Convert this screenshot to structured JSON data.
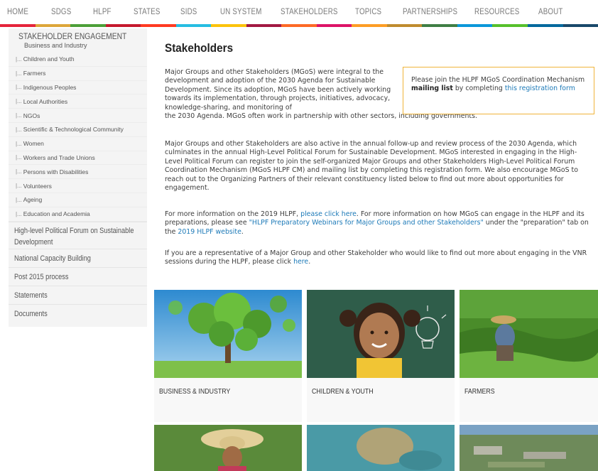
{
  "nav": {
    "items": [
      "HOME",
      "SDGS",
      "HLPF",
      "STATES",
      "SIDS",
      "UN SYSTEM",
      "STAKEHOLDERS",
      "TOPICS",
      "PARTNERSHIPS",
      "RESOURCES",
      "ABOUT"
    ]
  },
  "sdg_colors": [
    "#e5243b",
    "#dda63a",
    "#4c9f38",
    "#c5192d",
    "#ff3a21",
    "#26bde2",
    "#fcc30b",
    "#a21942",
    "#fd6925",
    "#dd1367",
    "#fd9d24",
    "#bf8b2e",
    "#3f7e44",
    "#0a97d9",
    "#56c02b",
    "#00689d",
    "#19486a"
  ],
  "sidebar": {
    "title": "STAKEHOLDER ENGAGEMENT",
    "subtitle": "Business and Industry",
    "tree_mark": "|...",
    "children": [
      "Children and Youth",
      "Farmers",
      "Indigenous Peoples",
      "Local Authorities",
      "NGOs",
      "Scientific & Technological Community",
      "Women",
      "Workers and Trade Unions",
      "Persons with Disabilities",
      "Volunteers",
      "Ageing",
      "Education and Academia"
    ],
    "main_items": [
      "High-level Political Forum on Sustainable Development",
      "National Capacity Building",
      "Post 2015 process",
      "Statements",
      "Documents"
    ]
  },
  "content": {
    "title": "Stakeholders",
    "p1": "Major Groups and other Stakeholders (MGoS) were integral to the development and adoption of the 2030 Agenda for Sustainable Development. Since its adoption, MGoS have been actively working towards its implementation, through projects, initiatives, advocacy, knowledge-sharing, and monitoring of",
    "p1_tail": "the 2030 Agenda. MGoS often work in partnership with other sectors, including governments.",
    "p2": "Major Groups and other Stakeholders are also active in the annual follow-up and review process of the 2030 Agenda, which culminates in the annual High-Level Political Forum for Sustainable Development. MGoS interested in engaging in the High-Level Political Forum can register to join the self-organized Major Groups and other Stakeholders High-Level Political Forum Coordination Mechanism (MGoS HLPF CM) and mailing list by completing this registration form. We also encourage MGoS to reach out to the Organizing Partners of their relevant constituency listed below to find out more about opportunities for engagement.",
    "p3_a": "For more information on the 2019 HLPF,",
    "p3_link1": "please click here",
    "p3_b": ". For more information on how MGoS can engage in the HLPF and its preparations, please see",
    "p3_link2": "\"HLPF Preparatory Webinars for Major Groups and other Stakeholders\"",
    "p3_c": "under the \"preparation\" tab on the",
    "p3_link3": "2019 HLPF website",
    "p3_d": ".",
    "p4_a": "If you are a representative of a Major Group and other Stakeholder who would like to find out more about engaging in the VNR sessions during the HLPF, please click",
    "p4_link": "here",
    "p4_b": "."
  },
  "callout": {
    "text_a": "Please join the HLPF MGoS Coordination Mechanism",
    "bold": "mailing list",
    "text_b": "by completing",
    "link": "this registration form"
  },
  "cards": [
    {
      "label": "BUSINESS & INDUSTRY"
    },
    {
      "label": "CHILDREN & YOUTH"
    },
    {
      "label": "FARMERS"
    }
  ]
}
